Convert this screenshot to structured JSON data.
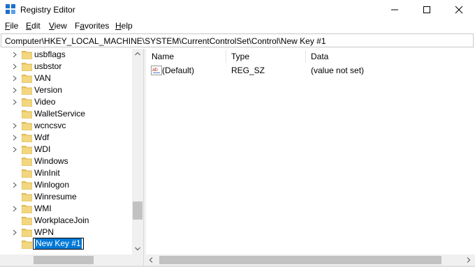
{
  "window": {
    "title": "Registry Editor",
    "controls": [
      "minimize",
      "maximize",
      "close"
    ]
  },
  "menu": {
    "items": [
      {
        "label": "File",
        "mnemonic": "F",
        "rest": "ile"
      },
      {
        "label": "Edit",
        "mnemonic": "E",
        "rest": "dit"
      },
      {
        "label": "View",
        "mnemonic": "V",
        "rest": "iew"
      },
      {
        "label": "Favorites",
        "mnemonic": "a",
        "prefix": "F",
        "rest": "vorites"
      },
      {
        "label": "Help",
        "mnemonic": "H",
        "rest": "elp"
      }
    ]
  },
  "address": {
    "path": "Computer\\HKEY_LOCAL_MACHINE\\SYSTEM\\CurrentControlSet\\Control\\New Key #1"
  },
  "tree": {
    "items": [
      {
        "label": "usbflags",
        "expandable": true
      },
      {
        "label": "usbstor",
        "expandable": true
      },
      {
        "label": "VAN",
        "expandable": true
      },
      {
        "label": "Version",
        "expandable": true
      },
      {
        "label": "Video",
        "expandable": true
      },
      {
        "label": "WalletService",
        "expandable": false
      },
      {
        "label": "wcncsvc",
        "expandable": true
      },
      {
        "label": "Wdf",
        "expandable": true
      },
      {
        "label": "WDI",
        "expandable": true
      },
      {
        "label": "Windows",
        "expandable": false
      },
      {
        "label": "WinInit",
        "expandable": false
      },
      {
        "label": "Winlogon",
        "expandable": true
      },
      {
        "label": "Winresume",
        "expandable": false
      },
      {
        "label": "WMI",
        "expandable": true
      },
      {
        "label": "WorkplaceJoin",
        "expandable": false
      },
      {
        "label": "WPN",
        "expandable": true
      }
    ],
    "editing_item": {
      "label": "New Key #1"
    }
  },
  "list": {
    "columns": [
      "Name",
      "Type",
      "Data"
    ],
    "rows": [
      {
        "icon": "string-value-icon",
        "name": "(Default)",
        "type": "REG_SZ",
        "data": "(value not set)"
      }
    ]
  },
  "colors": {
    "folder": "#e8c25b",
    "selection": "#0078d7",
    "app_icon": "#1e6fc7"
  }
}
